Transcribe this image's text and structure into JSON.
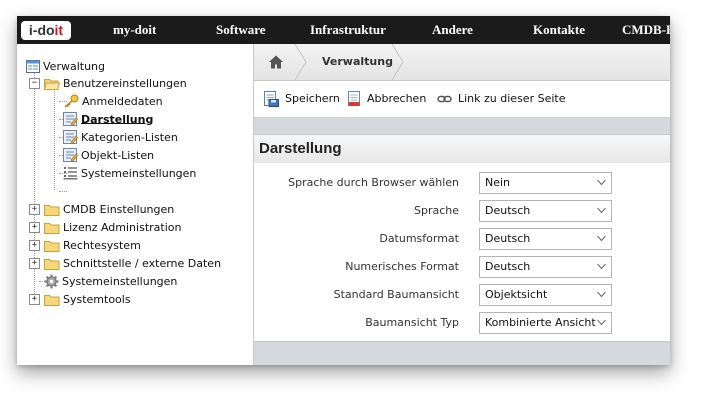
{
  "logo": {
    "prefix": "i-do",
    "suffix": "it"
  },
  "nav": [
    {
      "label": "my-doit"
    },
    {
      "label": "Software"
    },
    {
      "label": "Infrastruktur"
    },
    {
      "label": "Andere"
    },
    {
      "label": "Kontakte"
    },
    {
      "label": "CMDB-Ex"
    }
  ],
  "tree": {
    "root": "Verwaltung",
    "benutzer": "Benutzereinstellungen",
    "anmeldedaten": "Anmeldedaten",
    "darstellung": "Darstellung",
    "kategorien": "Kategorien-Listen",
    "objekt": "Objekt-Listen",
    "system_sub": "Systemeinstellungen",
    "cmdb": "CMDB Einstellungen",
    "lizenz": "Lizenz Administration",
    "rechte": "Rechtesystem",
    "schnitt": "Schnittstelle / externe Daten",
    "systemeinst": "Systemeinstellungen",
    "systemtools": "Systemtools"
  },
  "breadcrumb": {
    "label": "Verwaltung"
  },
  "toolbar": {
    "save": "Speichern",
    "cancel": "Abbrechen",
    "link": "Link zu dieser Seite"
  },
  "section": {
    "title": "Darstellung"
  },
  "form": [
    {
      "label": "Sprache durch Browser wählen",
      "value": "Nein"
    },
    {
      "label": "Sprache",
      "value": "Deutsch"
    },
    {
      "label": "Datumsformat",
      "value": "Deutsch"
    },
    {
      "label": "Numerisches Format",
      "value": "Deutsch"
    },
    {
      "label": "Standard Baumansicht",
      "value": "Objektsicht"
    },
    {
      "label": "Baumansicht Typ",
      "value": "Kombinierte Ansicht"
    }
  ],
  "colors": {
    "nav_bg": "#1b1b1b",
    "logo_accent": "#d0121b",
    "panel_bg": "#d5d9de"
  }
}
